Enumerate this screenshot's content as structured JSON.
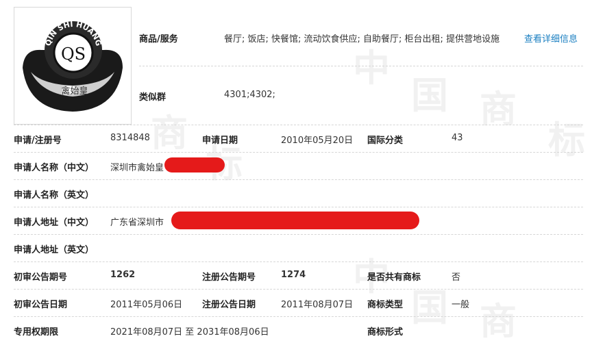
{
  "logo": {
    "ring_text": "QIN SHI HUANG",
    "center_text": "QS",
    "bottom_text": "禽始皇"
  },
  "goods": {
    "label": "商品/服务",
    "value": "餐厅; 饭店; 快餐馆; 流动饮食供应; 自助餐厅; 柜台出租; 提供营地设施",
    "link": "查看详细信息"
  },
  "similar_group": {
    "label": "类似群",
    "value": "4301;4302;"
  },
  "rows": {
    "reg_no": {
      "label": "申请/注册号",
      "value": "8314848"
    },
    "apply_date": {
      "label": "申请日期",
      "value": "2010年05月20日"
    },
    "intl_class": {
      "label": "国际分类",
      "value": "43"
    },
    "applicant_cn": {
      "label": "申请人名称（中文）",
      "value": "深圳市禽始皇"
    },
    "applicant_en": {
      "label": "申请人名称（英文）",
      "value": ""
    },
    "address_cn": {
      "label": "申请人地址（中文）",
      "value": "广东省深圳市"
    },
    "address_en": {
      "label": "申请人地址（英文）",
      "value": ""
    },
    "prelim_pub_no": {
      "label": "初审公告期号",
      "value": "1262"
    },
    "reg_pub_no": {
      "label": "注册公告期号",
      "value": "1274"
    },
    "shared": {
      "label": "是否共有商标",
      "value": "否"
    },
    "prelim_pub_date": {
      "label": "初审公告日期",
      "value": "2011年05月06日"
    },
    "reg_pub_date": {
      "label": "注册公告日期",
      "value": "2011年08月07日"
    },
    "mark_type": {
      "label": "商标类型",
      "value": "一般"
    },
    "exclusive_term": {
      "label": "专用权期限",
      "value": "2021年08月07日 至 2031年08月06日"
    },
    "mark_form": {
      "label": "商标形式",
      "value": ""
    }
  },
  "colors": {
    "link": "#1a7fc1",
    "redaction": "#e51a1a"
  }
}
